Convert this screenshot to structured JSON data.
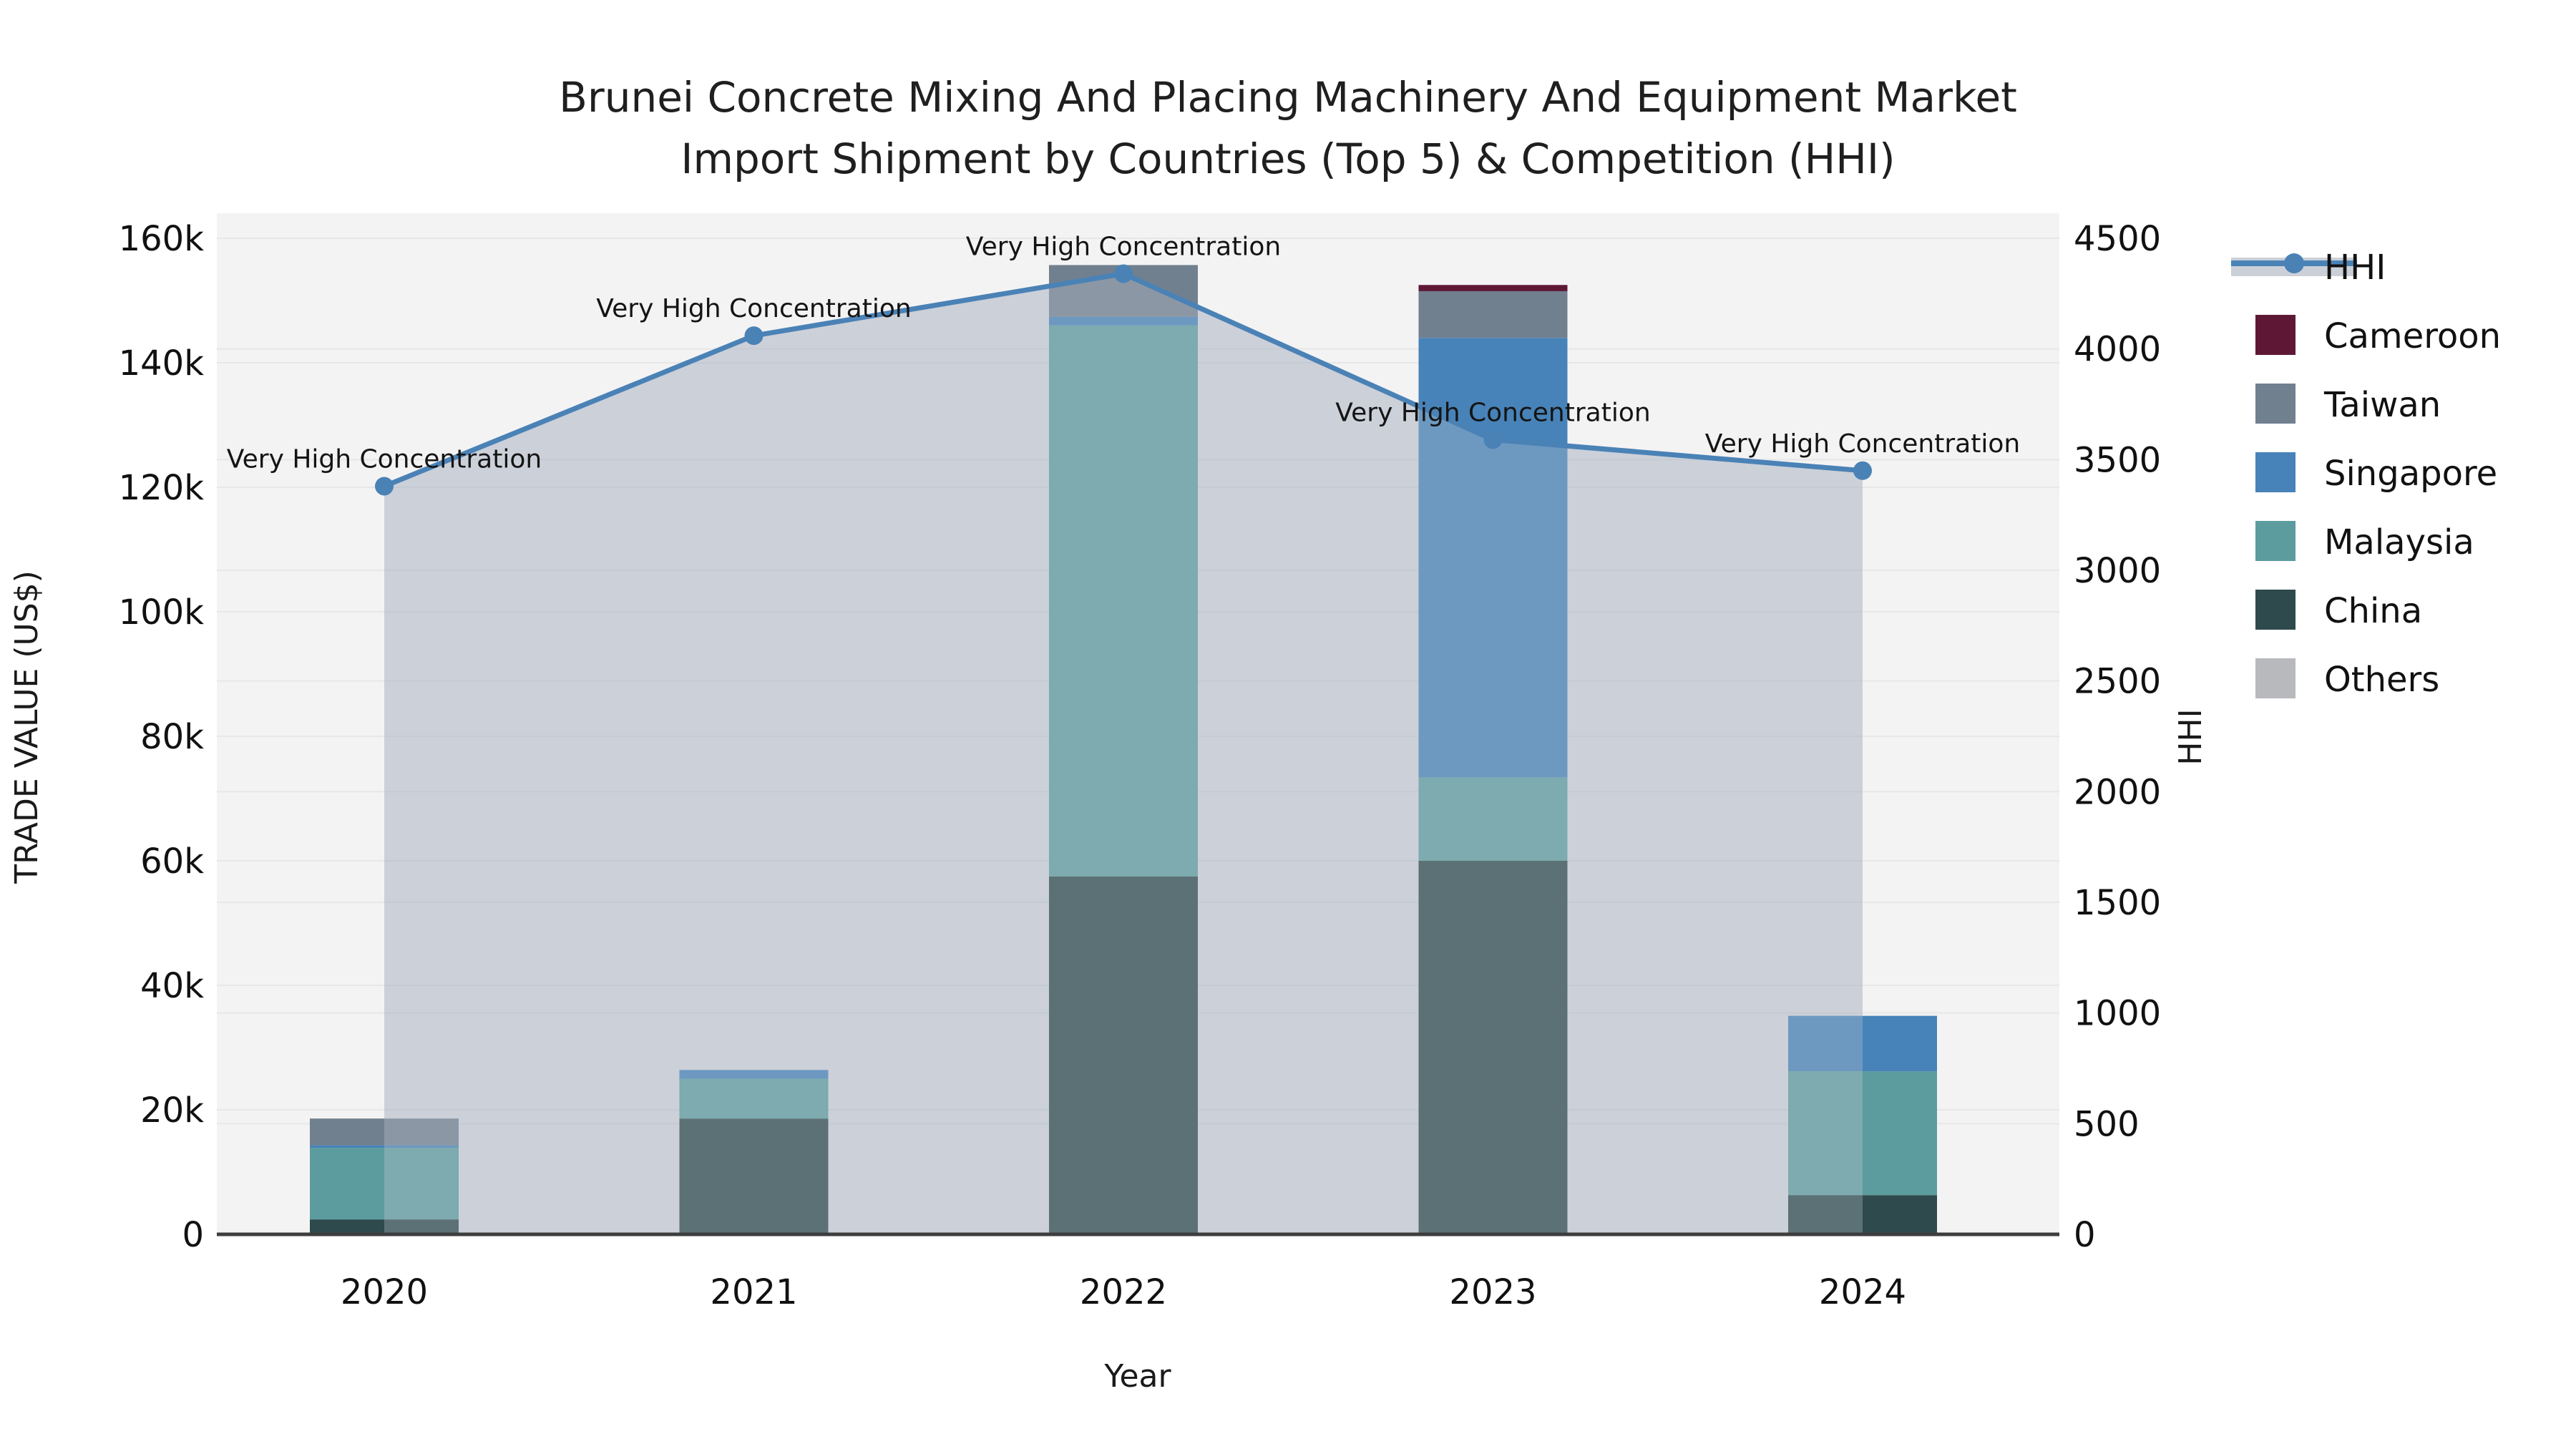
{
  "chart_data": {
    "type": "bar+line",
    "title_line1": "Brunei Concrete Mixing And Placing Machinery And Equipment Market",
    "title_line2": "Import Shipment by Countries (Top 5) & Competition (HHI)",
    "xlabel": "Year",
    "ylabel": "TRADE VALUE (US$)",
    "y2label": "HHI",
    "categories": [
      "2020",
      "2021",
      "2022",
      "2023",
      "2024"
    ],
    "series": [
      {
        "name": "China",
        "color": "#2e4a4c",
        "values": [
          2400,
          18600,
          57500,
          60000,
          6300
        ]
      },
      {
        "name": "Malaysia",
        "color": "#5d9c9e",
        "values": [
          11500,
          6400,
          88500,
          13400,
          19900
        ]
      },
      {
        "name": "Singapore",
        "color": "#4783b8",
        "values": [
          400,
          1400,
          1400,
          70600,
          8900
        ]
      },
      {
        "name": "Taiwan",
        "color": "#71808f",
        "values": [
          4300,
          0,
          8300,
          7500,
          0
        ]
      },
      {
        "name": "Cameroon",
        "color": "#5e1836",
        "values": [
          0,
          0,
          0,
          1000,
          0
        ]
      },
      {
        "name": "Others",
        "color": "#b7b9bc",
        "values": [
          0,
          0,
          0,
          0,
          0
        ]
      }
    ],
    "hhi_series": {
      "name": "HHI",
      "line_color": "#4a82b6",
      "area_fill_color": "#cbd0d8",
      "values": [
        3380,
        4060,
        4340,
        3590,
        3450
      ]
    },
    "annotation_text": "Very High Concentration",
    "annotations_per_point": [
      "Very High Concentration",
      "Very High Concentration",
      "Very High Concentration",
      "Very High Concentration",
      "Very High Concentration"
    ],
    "y_axis": {
      "min": 0,
      "max": 160000,
      "dtick": 20000,
      "tick_labels": [
        "0",
        "20k",
        "40k",
        "60k",
        "80k",
        "100k",
        "120k",
        "140k",
        "160k"
      ]
    },
    "y2_axis": {
      "min": 0,
      "max": 4500,
      "dtick": 500,
      "tick_labels": [
        "0",
        "500",
        "1000",
        "1500",
        "2000",
        "2500",
        "3000",
        "3500",
        "4000",
        "4500"
      ]
    },
    "legend_order": [
      "HHI",
      "Cameroon",
      "Taiwan",
      "Singapore",
      "Malaysia",
      "China",
      "Others"
    ],
    "layout_hints": {
      "grid": true,
      "legend_position": "right-outside",
      "plot_bg": "#f4f3f3",
      "grid_color": "#e7e7e9",
      "axis_line_color": "#3d3d3d"
    }
  }
}
